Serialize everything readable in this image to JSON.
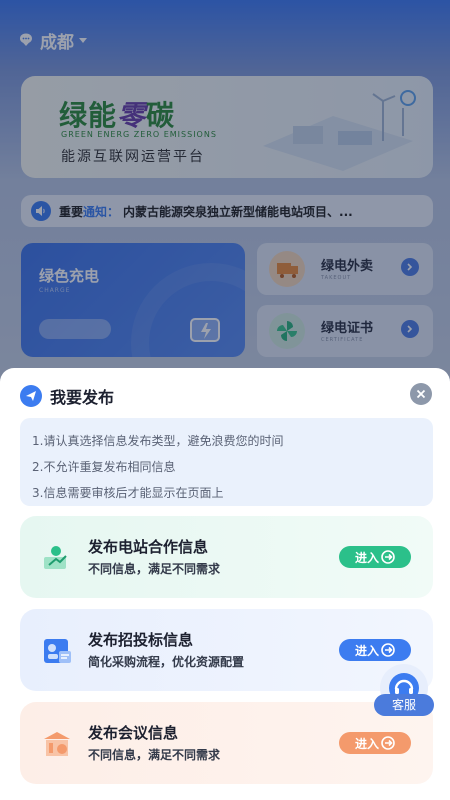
{
  "header": {
    "city": "成都"
  },
  "banner": {
    "logo_part1": "绿能",
    "logo_part2": "零",
    "logo_part3": "碳",
    "subtitle": "GREEN ENERG ZERO EMISSIONS",
    "slogan": "能源互联网运营平台"
  },
  "notice": {
    "label": "重要",
    "label_accent": "通知：",
    "text": "内蒙古能源突泉独立新型储能电站项目、..."
  },
  "services": {
    "charge": {
      "title": "绿色充电",
      "en": "CHARGE"
    },
    "takeout": {
      "title": "绿电外卖",
      "en": "TAKEOUT"
    },
    "certificate": {
      "title": "绿电证书",
      "en": "CERTIFICATE"
    }
  },
  "sheet": {
    "title": "我要发布",
    "tips": [
      "1.请认真选择信息发布类型，避免浪费您的时间",
      "2.不允许重复发布相同信息",
      "3.信息需要审核后才能显示在页面上"
    ],
    "options": [
      {
        "title": "发布电站合作信息",
        "desc": "不同信息，满足不同需求",
        "enter": "进入"
      },
      {
        "title": "发布招投标信息",
        "desc": "简化采购流程，优化资源配置",
        "enter": "进入"
      },
      {
        "title": "发布会议信息",
        "desc": "不同信息，满足不同需求",
        "enter": "进入"
      }
    ]
  },
  "customer_service": {
    "label": "客服"
  },
  "colors": {
    "primary": "#3c7cf0",
    "green": "#2bc08a",
    "orange": "#f49a6c"
  }
}
